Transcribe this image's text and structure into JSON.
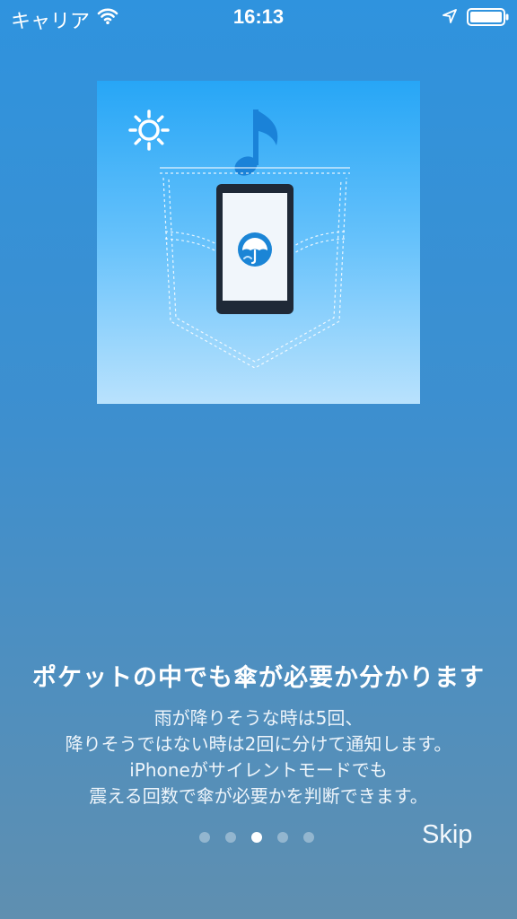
{
  "status_bar": {
    "carrier": "キャリア",
    "time": "16:13",
    "icons": [
      "wifi-icon",
      "location-arrow-icon",
      "battery-icon"
    ]
  },
  "illustration": {
    "icons": [
      "sun-icon",
      "music-note-icon",
      "jeans-pocket",
      "phone-icon",
      "umbrella-app-icon"
    ]
  },
  "onboarding": {
    "headline": "ポケットの中でも傘が必要か分かります",
    "description_lines": [
      "雨が降りそうな時は5回、",
      "降りそうではない時は2回に分けて通知します。",
      "iPhoneがサイレントモードでも",
      "震える回数で傘が必要かを判断できます。"
    ],
    "pagination": {
      "total": 5,
      "current": 3
    },
    "skip_label": "Skip"
  }
}
